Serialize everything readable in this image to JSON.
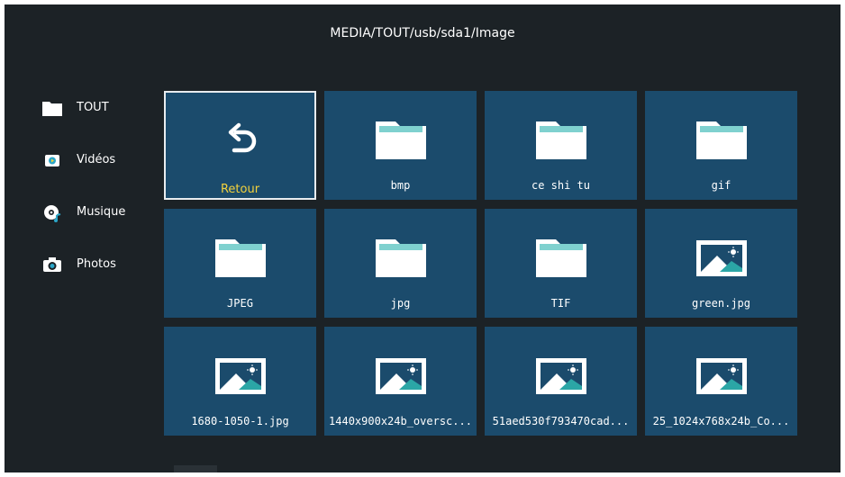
{
  "path": "MEDIA/TOUT/usb/sda1/Image",
  "sidebar": {
    "items": [
      {
        "label": "TOUT",
        "icon": "folder-icon"
      },
      {
        "label": "Vidéos",
        "icon": "video-icon"
      },
      {
        "label": "Musique",
        "icon": "music-icon"
      },
      {
        "label": "Photos",
        "icon": "camera-icon"
      }
    ]
  },
  "tiles": [
    {
      "label": "Retour",
      "icon": "back-arrow-icon",
      "selected": true
    },
    {
      "label": "bmp",
      "icon": "folder-icon"
    },
    {
      "label": "ce shi tu",
      "icon": "folder-icon"
    },
    {
      "label": "gif",
      "icon": "folder-icon"
    },
    {
      "label": "JPEG",
      "icon": "folder-icon"
    },
    {
      "label": "jpg",
      "icon": "folder-icon"
    },
    {
      "label": "TIF",
      "icon": "folder-icon"
    },
    {
      "label": "green.jpg",
      "icon": "image-icon"
    },
    {
      "label": "1680-1050-1.jpg",
      "icon": "image-icon"
    },
    {
      "label": "1440x900x24b_oversc...",
      "icon": "image-icon"
    },
    {
      "label": "51aed530f793470cad...",
      "icon": "image-icon"
    },
    {
      "label": "25_1024x768x24b_Co...",
      "icon": "image-icon"
    }
  ],
  "colors": {
    "background": "#1c2226",
    "tile": "#1b4b6c",
    "selected_label": "#f3d23c",
    "folder_tab": "#7fd1cf"
  }
}
